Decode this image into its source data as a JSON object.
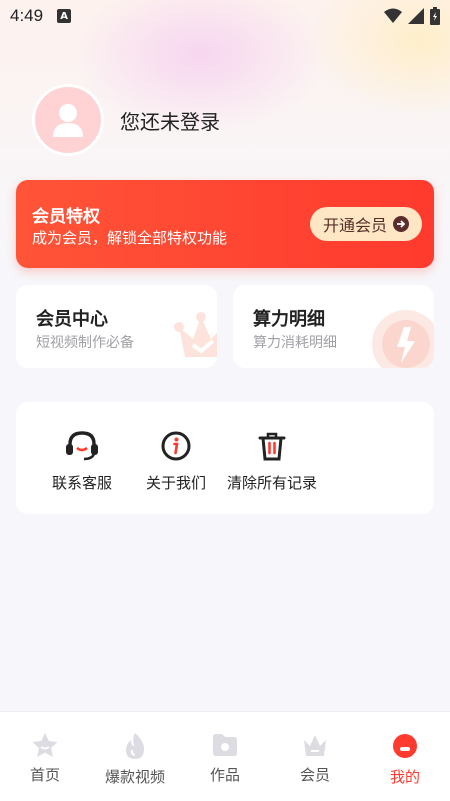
{
  "status_bar": {
    "time": "4:49",
    "badge": "A"
  },
  "profile": {
    "login_text": "您还未登录"
  },
  "vip_banner": {
    "title": "会员特权",
    "subtitle": "成为会员，解锁全部特权功能",
    "button_label": "开通会员"
  },
  "cards": [
    {
      "title": "会员中心",
      "subtitle": "短视频制作必备"
    },
    {
      "title": "算力明细",
      "subtitle": "算力消耗明细"
    }
  ],
  "menu": [
    {
      "label": "联系客服",
      "icon": "headset-icon"
    },
    {
      "label": "关于我们",
      "icon": "info-icon"
    },
    {
      "label": "清除所有记录",
      "icon": "trash-icon"
    }
  ],
  "tabs": [
    {
      "label": "首页",
      "icon": "star-icon",
      "active": false
    },
    {
      "label": "爆款视频",
      "icon": "flame-icon",
      "active": false
    },
    {
      "label": "作品",
      "icon": "folder-icon",
      "active": false
    },
    {
      "label": "会员",
      "icon": "crown-icon",
      "active": false
    },
    {
      "label": "我的",
      "icon": "profile-icon",
      "active": true
    }
  ],
  "colors": {
    "accent": "#ff3b30",
    "vip_button_bg": "#ffe6c4",
    "inactive_icon": "#dcdce2"
  }
}
